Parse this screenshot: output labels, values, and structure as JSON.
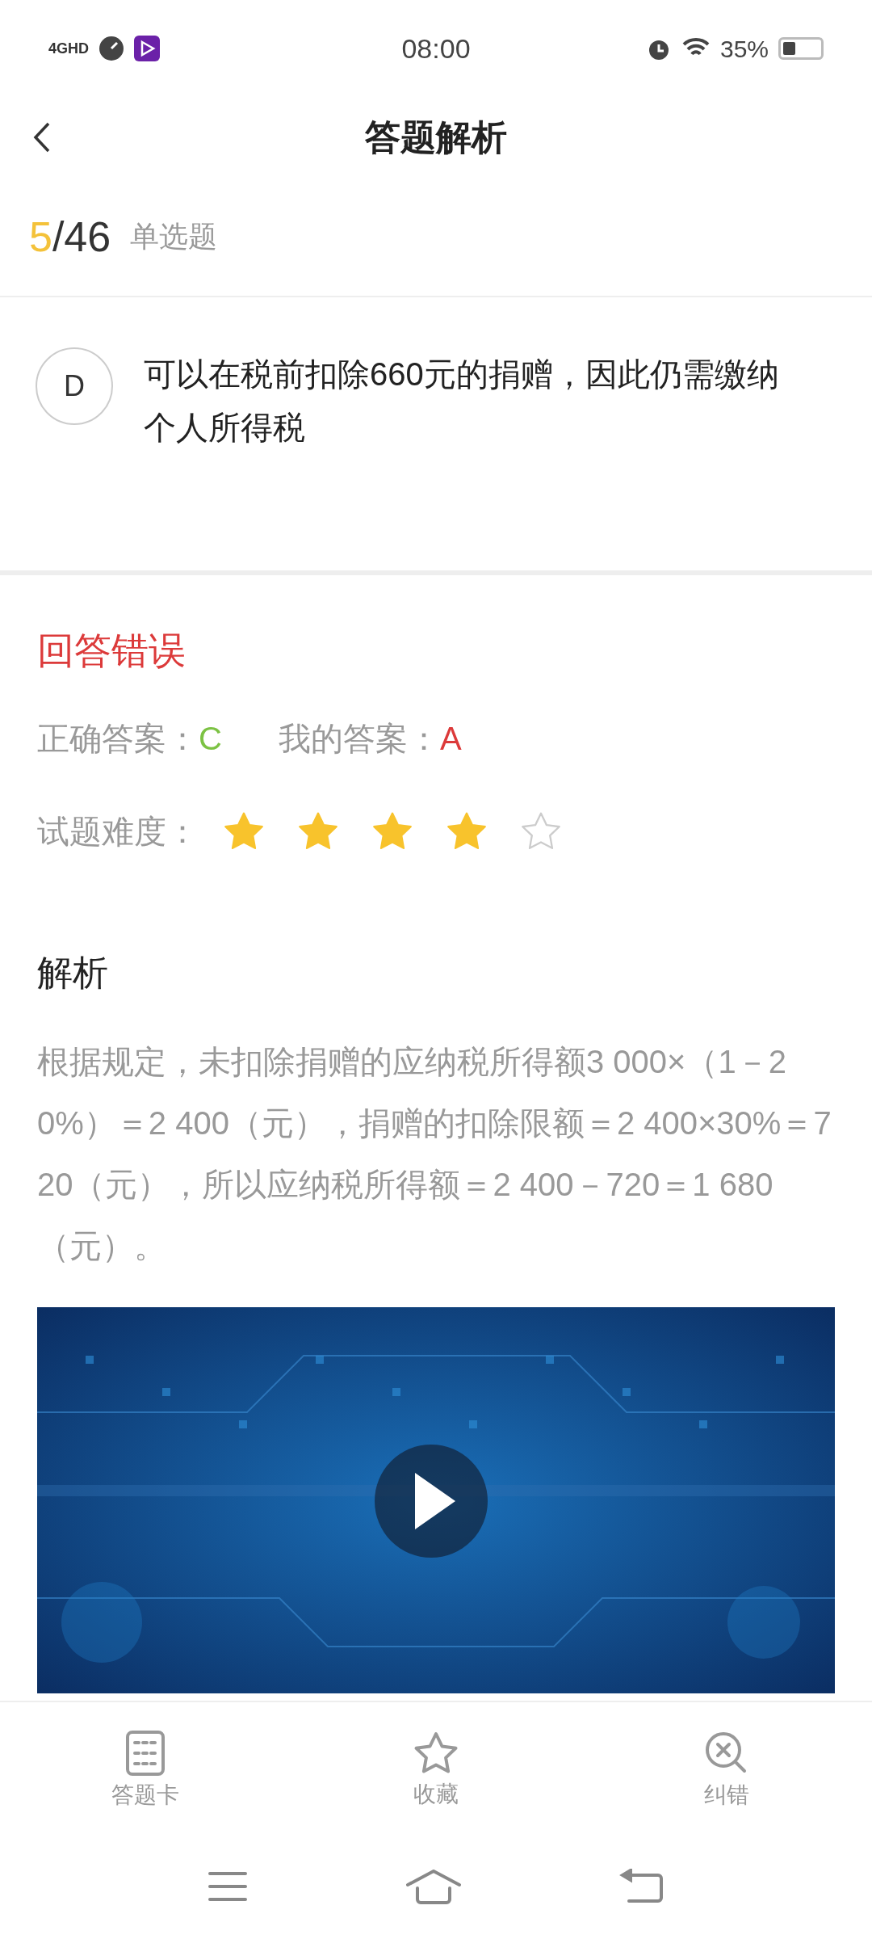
{
  "status_bar": {
    "network": "4GHD",
    "time": "08:00",
    "battery": "35%"
  },
  "header": {
    "title": "答题解析"
  },
  "progress": {
    "current": "5",
    "total": "/46",
    "type": "单选题"
  },
  "option": {
    "letter": "D",
    "text": "可以在税前扣除660元的捐赠，因此仍需缴纳个人所得税"
  },
  "result": {
    "verdict": "回答错误",
    "correct_label": "正确答案：",
    "correct_answer": "C",
    "my_label": "我的答案：",
    "my_answer": "A",
    "difficulty_label": "试题难度：",
    "stars": 4
  },
  "analysis": {
    "title": "解析",
    "text": "根据规定，未扣除捐赠的应纳税所得额3 000×（1－20%）＝2 400（元），捐赠的扣除限额＝2 400×30%＝720（元），所以应纳税所得额＝2 400－720＝1 680（元）。"
  },
  "bottom_tabs": [
    {
      "kind": "card",
      "label": "答题卡"
    },
    {
      "kind": "star",
      "label": "收藏"
    },
    {
      "kind": "report",
      "label": "纠错"
    }
  ]
}
